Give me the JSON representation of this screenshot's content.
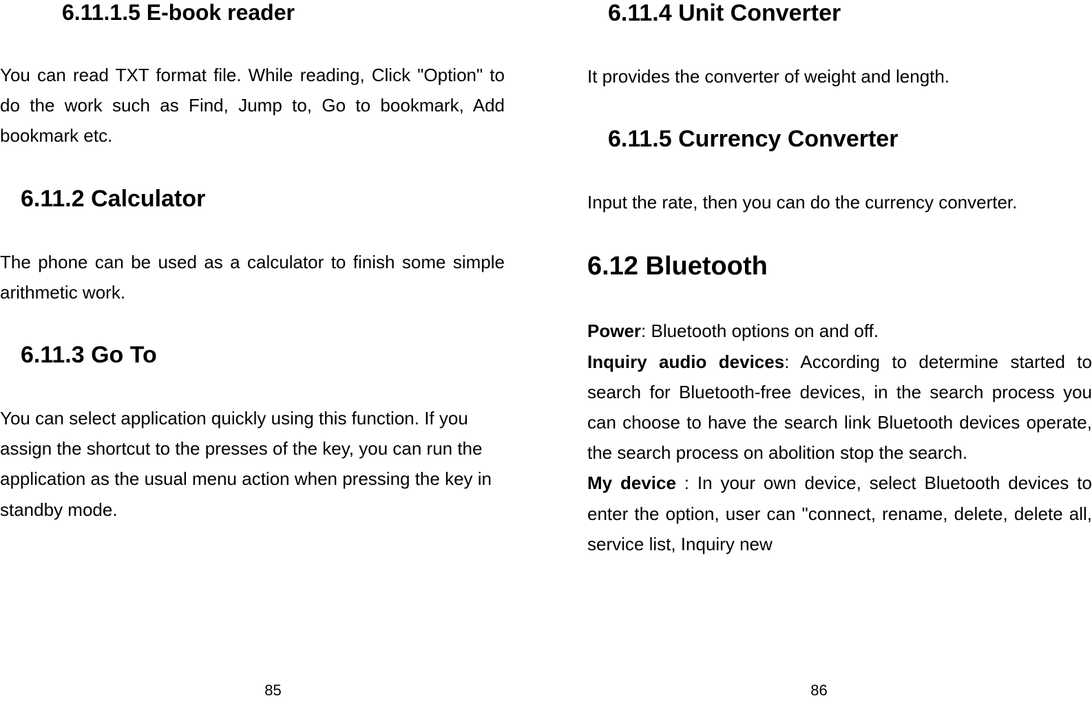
{
  "left_page": {
    "sections": {
      "ebook_reader": {
        "heading": "6.11.1.5  E-book reader",
        "body": "You can read TXT format file. While reading, Click \"Option\" to do the work such as Find, Jump to, Go to bookmark, Add bookmark etc."
      },
      "calculator": {
        "heading": "6.11.2  Calculator",
        "body": "The phone can be used as a calculator to finish some simple arithmetic work."
      },
      "goto": {
        "heading": "6.11.3  Go To",
        "body": "You can select application quickly using this function. If you assign the shortcut to the presses of the key, you can run the application as the usual menu action when pressing the key in standby mode."
      }
    },
    "page_number": "85"
  },
  "right_page": {
    "sections": {
      "unit_converter": {
        "heading": "6.11.4  Unit Converter",
        "body": "It provides the converter of weight and length."
      },
      "currency_converter": {
        "heading": "6.11.5  Currency Converter",
        "body": "Input the rate, then you can do the currency converter."
      },
      "bluetooth": {
        "heading": "6.12  Bluetooth",
        "power_label": "Power",
        "power_text": ": Bluetooth options on and off.",
        "inquiry_label": "Inquiry audio devices",
        "inquiry_text": ": According to determine started to search for Bluetooth-free devices, in the search process you can choose to have the search link Bluetooth devices operate, the search process on abolition stop the search.",
        "mydevice_label": "My device",
        "mydevice_text": " :  In your own device, select Bluetooth devices to enter the option, user can \"connect, rename, delete, delete all, service list, Inquiry new"
      }
    },
    "page_number": "86"
  }
}
